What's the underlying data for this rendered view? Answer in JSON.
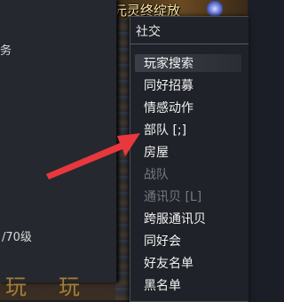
{
  "banner": {
    "title": "元灵终绽放"
  },
  "left_panel": {
    "frag_top": "务",
    "frag_bottom": "/70级"
  },
  "watermark": {
    "left": "玩",
    "right": "玩"
  },
  "menu": {
    "title": "社交",
    "items": [
      {
        "label": "玩家搜索",
        "enabled": true
      },
      {
        "label": "同好招募",
        "enabled": true
      },
      {
        "label": "情感动作",
        "enabled": true
      },
      {
        "label": "部队 [;]",
        "enabled": true
      },
      {
        "label": "房屋",
        "enabled": true
      },
      {
        "label": "战队",
        "enabled": false
      },
      {
        "label": "通讯贝 [L]",
        "enabled": false
      },
      {
        "label": "跨服通讯贝",
        "enabled": true
      },
      {
        "label": "同好会",
        "enabled": true
      },
      {
        "label": "好友名单",
        "enabled": true
      },
      {
        "label": "黑名单",
        "enabled": true
      }
    ]
  },
  "colors": {
    "arrow": "#e8383d",
    "accent_gold": "#ffe9a8"
  }
}
